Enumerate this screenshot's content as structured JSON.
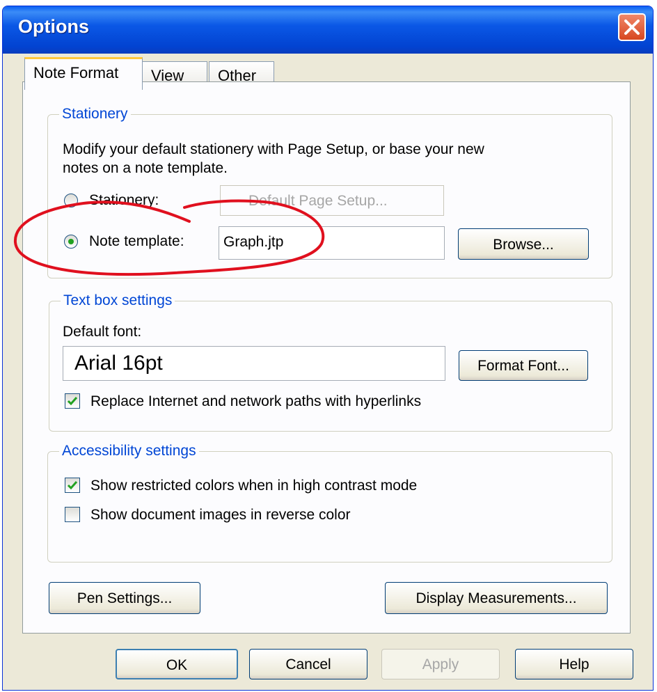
{
  "window": {
    "title": "Options"
  },
  "tabs": [
    {
      "label": "Note Format"
    },
    {
      "label": "View"
    },
    {
      "label": "Other"
    }
  ],
  "stationery": {
    "legend": "Stationery",
    "description_line1": "Modify your default stationery with Page Setup, or base your new",
    "description_line2": "notes on a note template.",
    "stationery_label": "Stationery:",
    "page_setup_button": "Default Page Setup...",
    "note_template_label": "Note template:",
    "note_template_value": "Graph.jtp",
    "browse_button": "Browse...",
    "selected": "Note template"
  },
  "textbox": {
    "legend": "Text box settings",
    "default_font_label": "Default font:",
    "default_font_value": "Arial 16pt",
    "format_font_button": "Format Font...",
    "replace_paths_label": "Replace Internet and network paths with hyperlinks",
    "replace_paths_checked": true
  },
  "accessibility": {
    "legend": "Accessibility settings",
    "restricted_colors_label": "Show restricted colors when in high contrast mode",
    "restricted_colors_checked": true,
    "reverse_color_label": "Show document images in reverse color",
    "reverse_color_checked": false
  },
  "bottom_buttons": {
    "pen_settings": "Pen Settings...",
    "display_measurements": "Display Measurements..."
  },
  "dialog_buttons": {
    "ok": "OK",
    "cancel": "Cancel",
    "apply": "Apply",
    "help": "Help"
  },
  "colors": {
    "titlebar": "#0a5ff2",
    "legend_text": "#0046d5",
    "annotation": "#e0101e",
    "check": "#21a121"
  }
}
